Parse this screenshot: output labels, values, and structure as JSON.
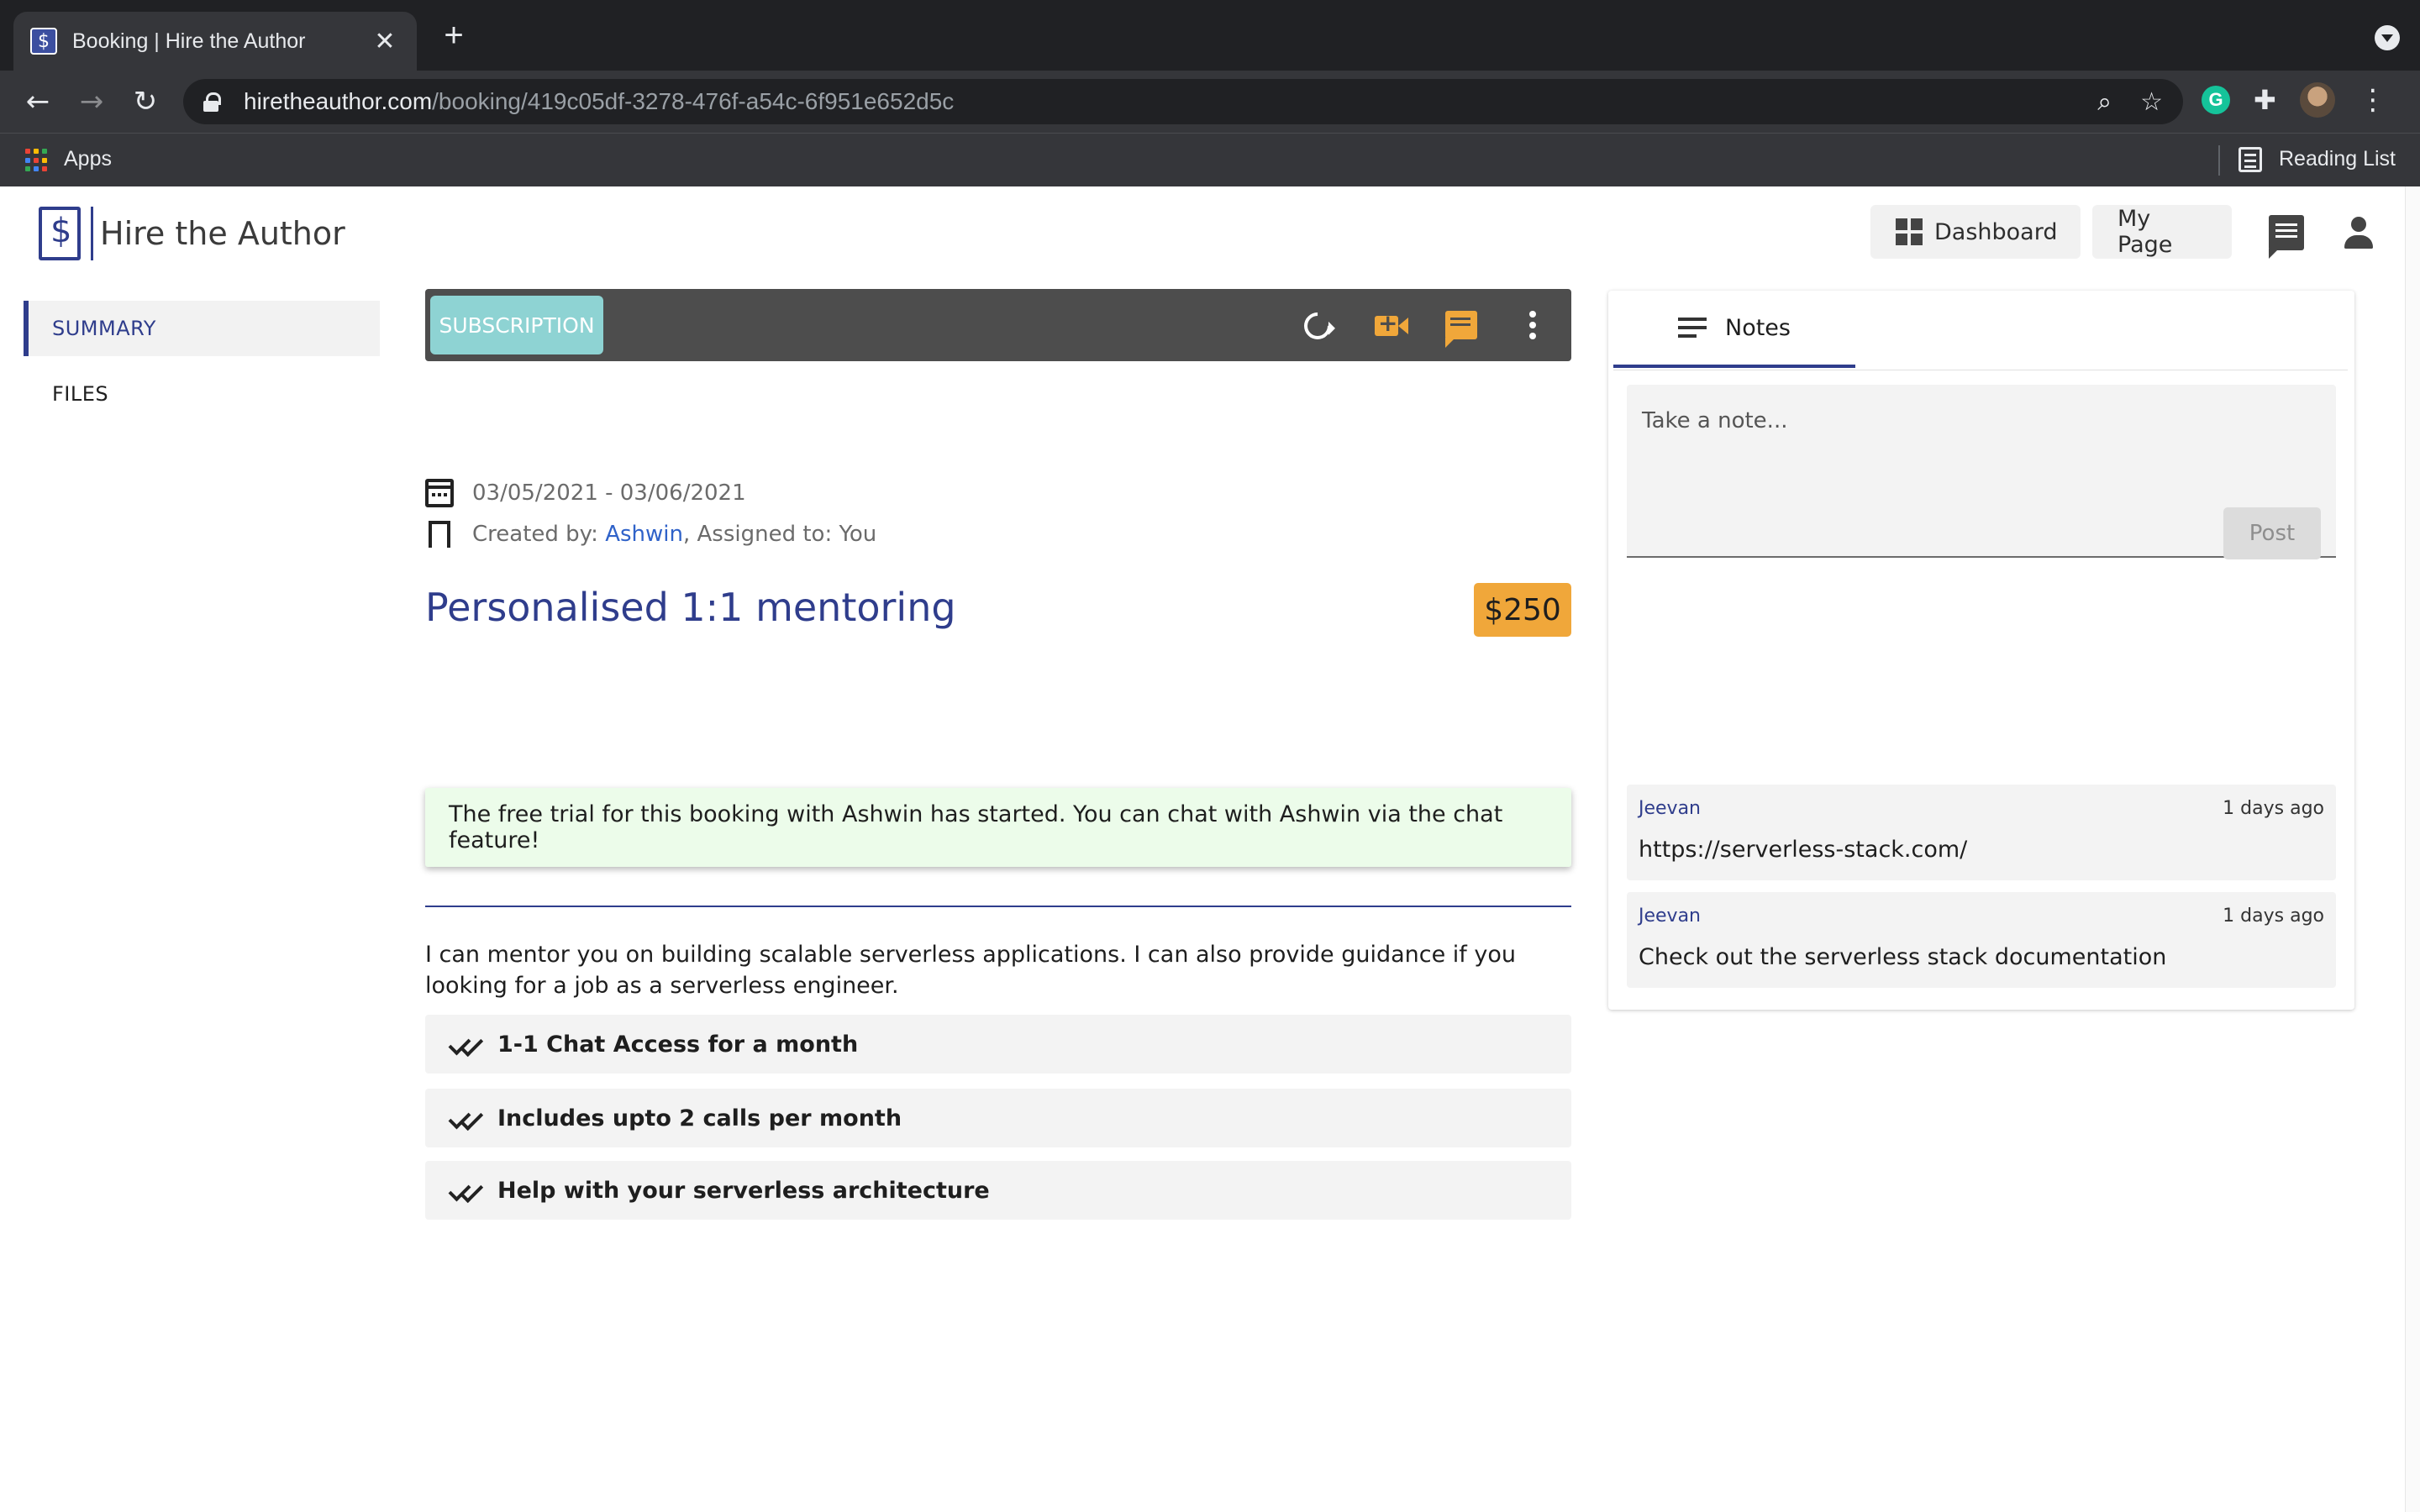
{
  "browser": {
    "tab_title": "Booking | Hire the Author",
    "url_host": "hiretheauthor.com",
    "url_path": "/booking/419c05df-3278-476f-a54c-6f951e652d5c",
    "bookmarks": {
      "apps_label": "Apps",
      "reading_list_label": "Reading List"
    }
  },
  "header": {
    "brand": "Hire the Author",
    "dashboard_label": "Dashboard",
    "my_page_label": "My Page"
  },
  "sidebar": {
    "items": [
      {
        "label": "SUMMARY",
        "active": true
      },
      {
        "label": "FILES",
        "active": false
      }
    ]
  },
  "booking": {
    "type_chip": "SUBSCRIPTION",
    "title": "Personalised 1:1 mentoring",
    "price": "$250",
    "date_range": "03/05/2021 - 03/06/2021",
    "created_by_prefix": "Created by: ",
    "created_by": "Ashwin",
    "assigned_to_text": ", Assigned to: You",
    "alert": "The free trial for this booking with Ashwin has started. You can chat with Ashwin via the chat feature!",
    "description": "I can mentor you on building scalable serverless applications. I can also provide guidance if you looking for a job as a serverless engineer.",
    "features": [
      "1-1 Chat Access for a month",
      "Includes upto 2 calls per month",
      "Help with your serverless architecture"
    ]
  },
  "notes": {
    "tab_label": "Notes",
    "input_placeholder": "Take a note...",
    "post_label": "Post",
    "items": [
      {
        "author": "Jeevan",
        "time": "1 days ago",
        "text": "https://serverless-stack.com/"
      },
      {
        "author": "Jeevan",
        "time": "1 days ago",
        "text": "Check out the serverless stack documentation"
      }
    ]
  },
  "colors": {
    "brand": "#2f3d8c",
    "accent": "#f0a73a",
    "chip": "#8ed3d3",
    "alert_bg": "#ecfcea"
  }
}
